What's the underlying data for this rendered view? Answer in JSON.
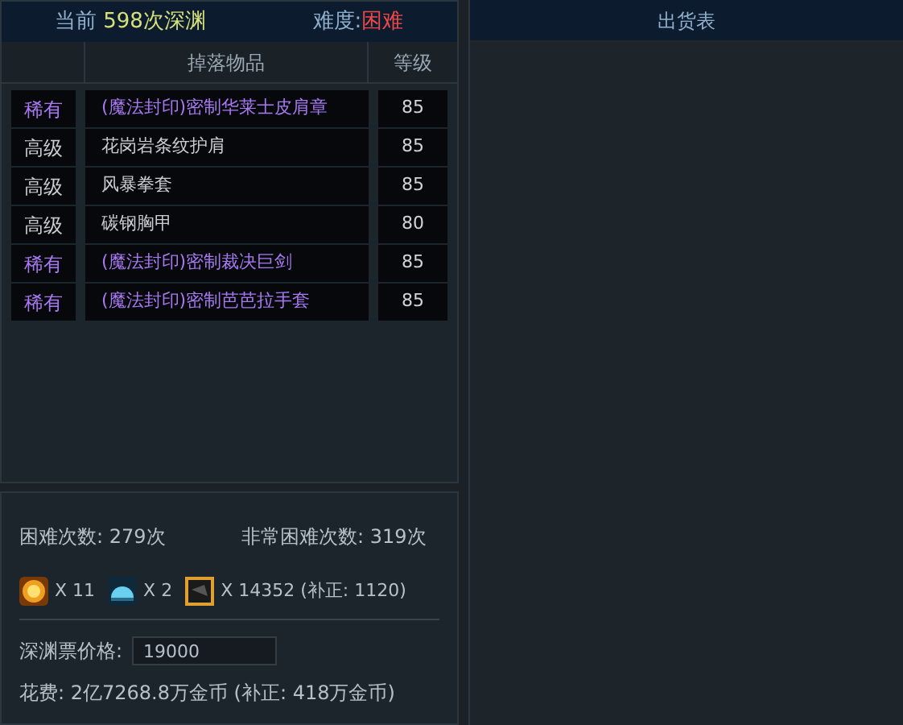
{
  "header": {
    "current_label": "当前",
    "current_value": "598次深渊",
    "difficulty_label": "难度:",
    "difficulty_value": "困难"
  },
  "drops": {
    "columns": [
      "掉落物品",
      "等级"
    ],
    "rows": [
      {
        "rarity": "稀有",
        "name": "(魔法封印)密制华莱士皮肩章",
        "level_text": "85",
        "kind": "rare"
      },
      {
        "rarity": "高级",
        "name": "花岗岩条纹护肩",
        "level_text": "85",
        "kind": "advanced"
      },
      {
        "rarity": "高级",
        "name": "风暴拳套",
        "level_text": "85",
        "kind": "advanced"
      },
      {
        "rarity": "高级",
        "name": "碳钢胸甲",
        "level_text": "80",
        "kind": "advanced"
      },
      {
        "rarity": "稀有",
        "name": "(魔法封印)密制裁决巨剑",
        "level_text": "85",
        "kind": "rare"
      },
      {
        "rarity": "稀有",
        "name": "(魔法封印)密制芭芭拉手套",
        "level_text": "85",
        "kind": "rare"
      }
    ]
  },
  "stats": {
    "hard_count": "困难次数: 279次",
    "very_hard_count": "非常困难次数: 319次",
    "items": [
      {
        "kind": "coin",
        "count": "X 11"
      },
      {
        "kind": "dome",
        "count": "X 2"
      },
      {
        "kind": "ticket",
        "count": "X 14352 (补正: 1120)"
      }
    ],
    "price_label": "深渊票价格:",
    "price_value": "19000",
    "cost": "花费: 2亿7268.8万金币 (补正: 418万金币)"
  },
  "shipping_table": {
    "title": "出货表"
  }
}
